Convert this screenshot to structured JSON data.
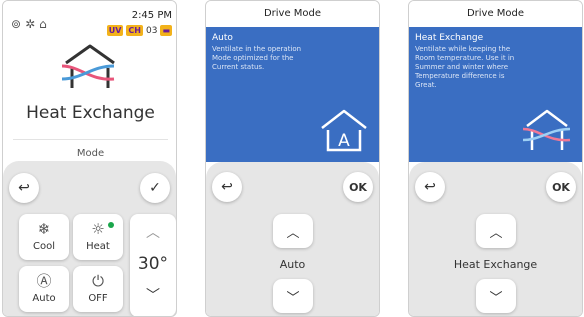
{
  "screen1": {
    "status": {
      "time": "2:45 PM",
      "badge_uv": "UV",
      "badge_ch": "CH",
      "ch_number": "03"
    },
    "mode_name": "Heat Exchange",
    "mode_label": "Mode",
    "buttons": {
      "cool": "Cool",
      "heat": "Heat",
      "auto": "Auto",
      "off": "OFF"
    },
    "temperature": "30°"
  },
  "screen2": {
    "header": "Drive Mode",
    "title": "Auto",
    "description": "Ventilate in the operation Mode optimized for the Current status.",
    "ok_label": "OK",
    "selected_mode": "Auto"
  },
  "screen3": {
    "header": "Drive Mode",
    "title": "Heat Exchange",
    "description": "Ventilate while keeping the Room temperature. Use it in Summer and winter where Temperature difference is Great.",
    "ok_label": "OK",
    "selected_mode": "Heat Exchange"
  },
  "colors": {
    "blue_panel": "#3a6ec2",
    "accent_green": "#1aa64b",
    "badge_yellow": "#f2b21b"
  }
}
